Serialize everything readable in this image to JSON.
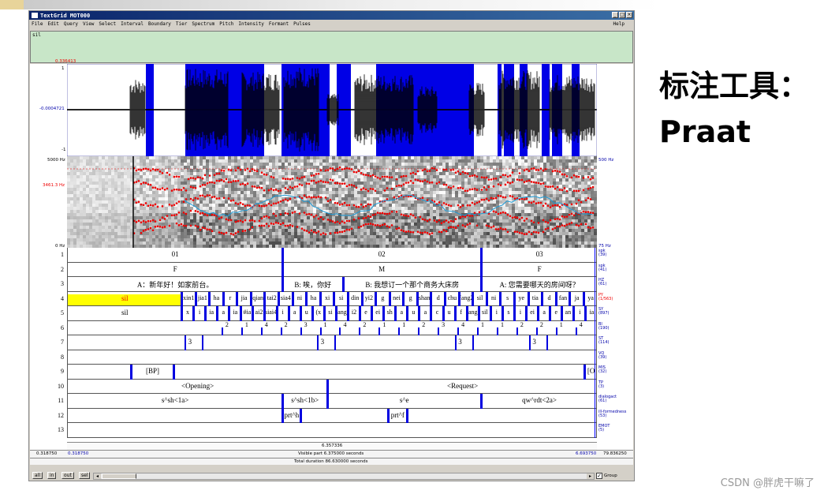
{
  "window": {
    "title": "TextGrid MOT000",
    "buttons": [
      "_",
      "□",
      "×"
    ]
  },
  "menu": [
    "File",
    "Edit",
    "Query",
    "View",
    "Select",
    "Interval",
    "Boundary",
    "Tier",
    "Spectrum",
    "Pitch",
    "Intensity",
    "Formant",
    "Pulses"
  ],
  "help": "Help",
  "textbox": "sil",
  "wave": {
    "top_value": "0.336413",
    "ymax": "1",
    "mid": "-0.0004721",
    "ymin": "-1"
  },
  "spectro": {
    "top": "5000 Hz",
    "bottom": "0 Hz",
    "cursor_freq": "3461.3 Hz",
    "right_top": "500 Hz",
    "right_bottom": "75 Hz"
  },
  "tiers": [
    {
      "num": "1",
      "name": "spk",
      "count": "(39)",
      "intervals": [
        "01",
        "02",
        "03"
      ]
    },
    {
      "num": "2",
      "name": "spk",
      "count": "(41)",
      "intervals": [
        "F",
        "M",
        "F"
      ]
    },
    {
      "num": "3",
      "name": "HZ",
      "count": "(61)",
      "intervals": [
        "A：新年好！如家前台。",
        "B: 唉，你好",
        "B: 我想订一个那个商务大床房",
        "A: 您需要哪天的房间呀？"
      ]
    },
    {
      "num": "4",
      "name": "PY",
      "count": "(1/563)",
      "intervals": [
        "sil",
        "xin1",
        "jia1",
        "ha",
        "r",
        "jia",
        "qian",
        "tai2",
        "sia4",
        "ni",
        "ha",
        "xi",
        "si",
        "din",
        "yi2",
        "g",
        "nei",
        "g",
        "shan",
        "d",
        "chu",
        "fang2",
        "sil",
        "ni",
        "s",
        "ye",
        "tia",
        "d",
        "fan",
        "ja",
        "ya"
      ]
    },
    {
      "num": "5",
      "name": "SY",
      "count": "(897)",
      "intervals": [
        "sil",
        "x",
        "i",
        "ia",
        "a",
        "ia",
        "#ia",
        "ai2",
        "siai4",
        "i",
        "a",
        "u",
        "(x",
        "si",
        "ang",
        "i2",
        "e",
        "ei",
        "sh",
        "a",
        "u",
        "a",
        "c",
        "u",
        "f",
        "ang",
        "sil",
        "i",
        "s",
        "i",
        "ei",
        "a",
        "e",
        "an",
        "i",
        "ia"
      ]
    },
    {
      "num": "6",
      "name": "BI",
      "count": "(190)",
      "marks": [
        "2",
        "1",
        "4",
        "2",
        "3",
        "1",
        "4",
        "2",
        "1",
        "1",
        "2",
        "3",
        "4",
        "1",
        "1",
        "2",
        "2",
        "1",
        "4"
      ]
    },
    {
      "num": "7",
      "name": "ST",
      "count": "(114)",
      "marks": [
        "3",
        "3",
        "3",
        "3"
      ]
    },
    {
      "num": "8",
      "name": "VQ",
      "count": "(39)"
    },
    {
      "num": "9",
      "name": "MIS",
      "count": "(32)",
      "intervals": [
        "[BP]",
        "[O"
      ]
    },
    {
      "num": "10",
      "name": "TP",
      "count": "(3)",
      "intervals": [
        "<Opening>",
        "<Request>"
      ]
    },
    {
      "num": "11",
      "name": "dialogact",
      "count": "(61)",
      "intervals": [
        "s^sh<1a>",
        "s^sh<1b>",
        "s^e",
        "qw^rdt<2a>"
      ]
    },
    {
      "num": "12",
      "name": "ill-formedness",
      "count": "(53)",
      "intervals": [
        "prt^h",
        "prt^f"
      ]
    },
    {
      "num": "13",
      "name": "EMOT",
      "count": "(5)"
    }
  ],
  "bottom": {
    "cursor": "6.357336",
    "left_total": "0.318750",
    "left_visible": "0.318750",
    "visible_part": "Visible part 6.375000 seconds",
    "right_visible": "6.693750",
    "right_total": "79.836250",
    "total_duration": "Total duration 86.630000 seconds"
  },
  "buttons": {
    "all": "all",
    "in": "in",
    "out": "out",
    "sel": "sel",
    "group": "Group"
  },
  "side_title": [
    "标注工具：",
    "Praat"
  ],
  "watermark": "CSDN @胖虎干嘛了"
}
